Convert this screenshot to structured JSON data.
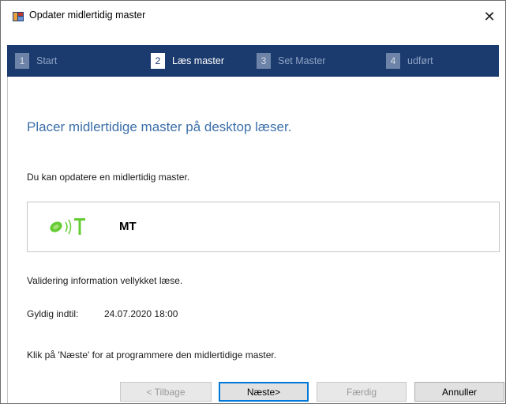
{
  "window": {
    "title": "Opdater midlertidig master",
    "close_glyph": "✕"
  },
  "steps": [
    {
      "num": "1",
      "label": "Start",
      "active": false
    },
    {
      "num": "2",
      "label": "Læs master",
      "active": true
    },
    {
      "num": "3",
      "label": "Set Master",
      "active": false
    },
    {
      "num": "4",
      "label": "udført",
      "active": false
    }
  ],
  "content": {
    "heading": "Placer midlertidige master på desktop læser.",
    "intro": "Du kan opdatere en midlertidig master.",
    "mt_label": "MT",
    "mt_icon": "card-reader-icon",
    "validation": "Validering information vellykket læse.",
    "valid_label": "Gyldig indtil:",
    "valid_value": "24.07.2020 18:00",
    "instruction": "Klik på 'Næste' for at programmere den midlertidige master."
  },
  "buttons": {
    "back": "< Tilbage",
    "next": "Næste>",
    "finish": "Færdig",
    "cancel": "Annuller"
  },
  "colors": {
    "step_bar": "#1b3b6f",
    "heading": "#3c6fa8",
    "icon_green": "#66cc33",
    "default_border": "#0078d7"
  }
}
